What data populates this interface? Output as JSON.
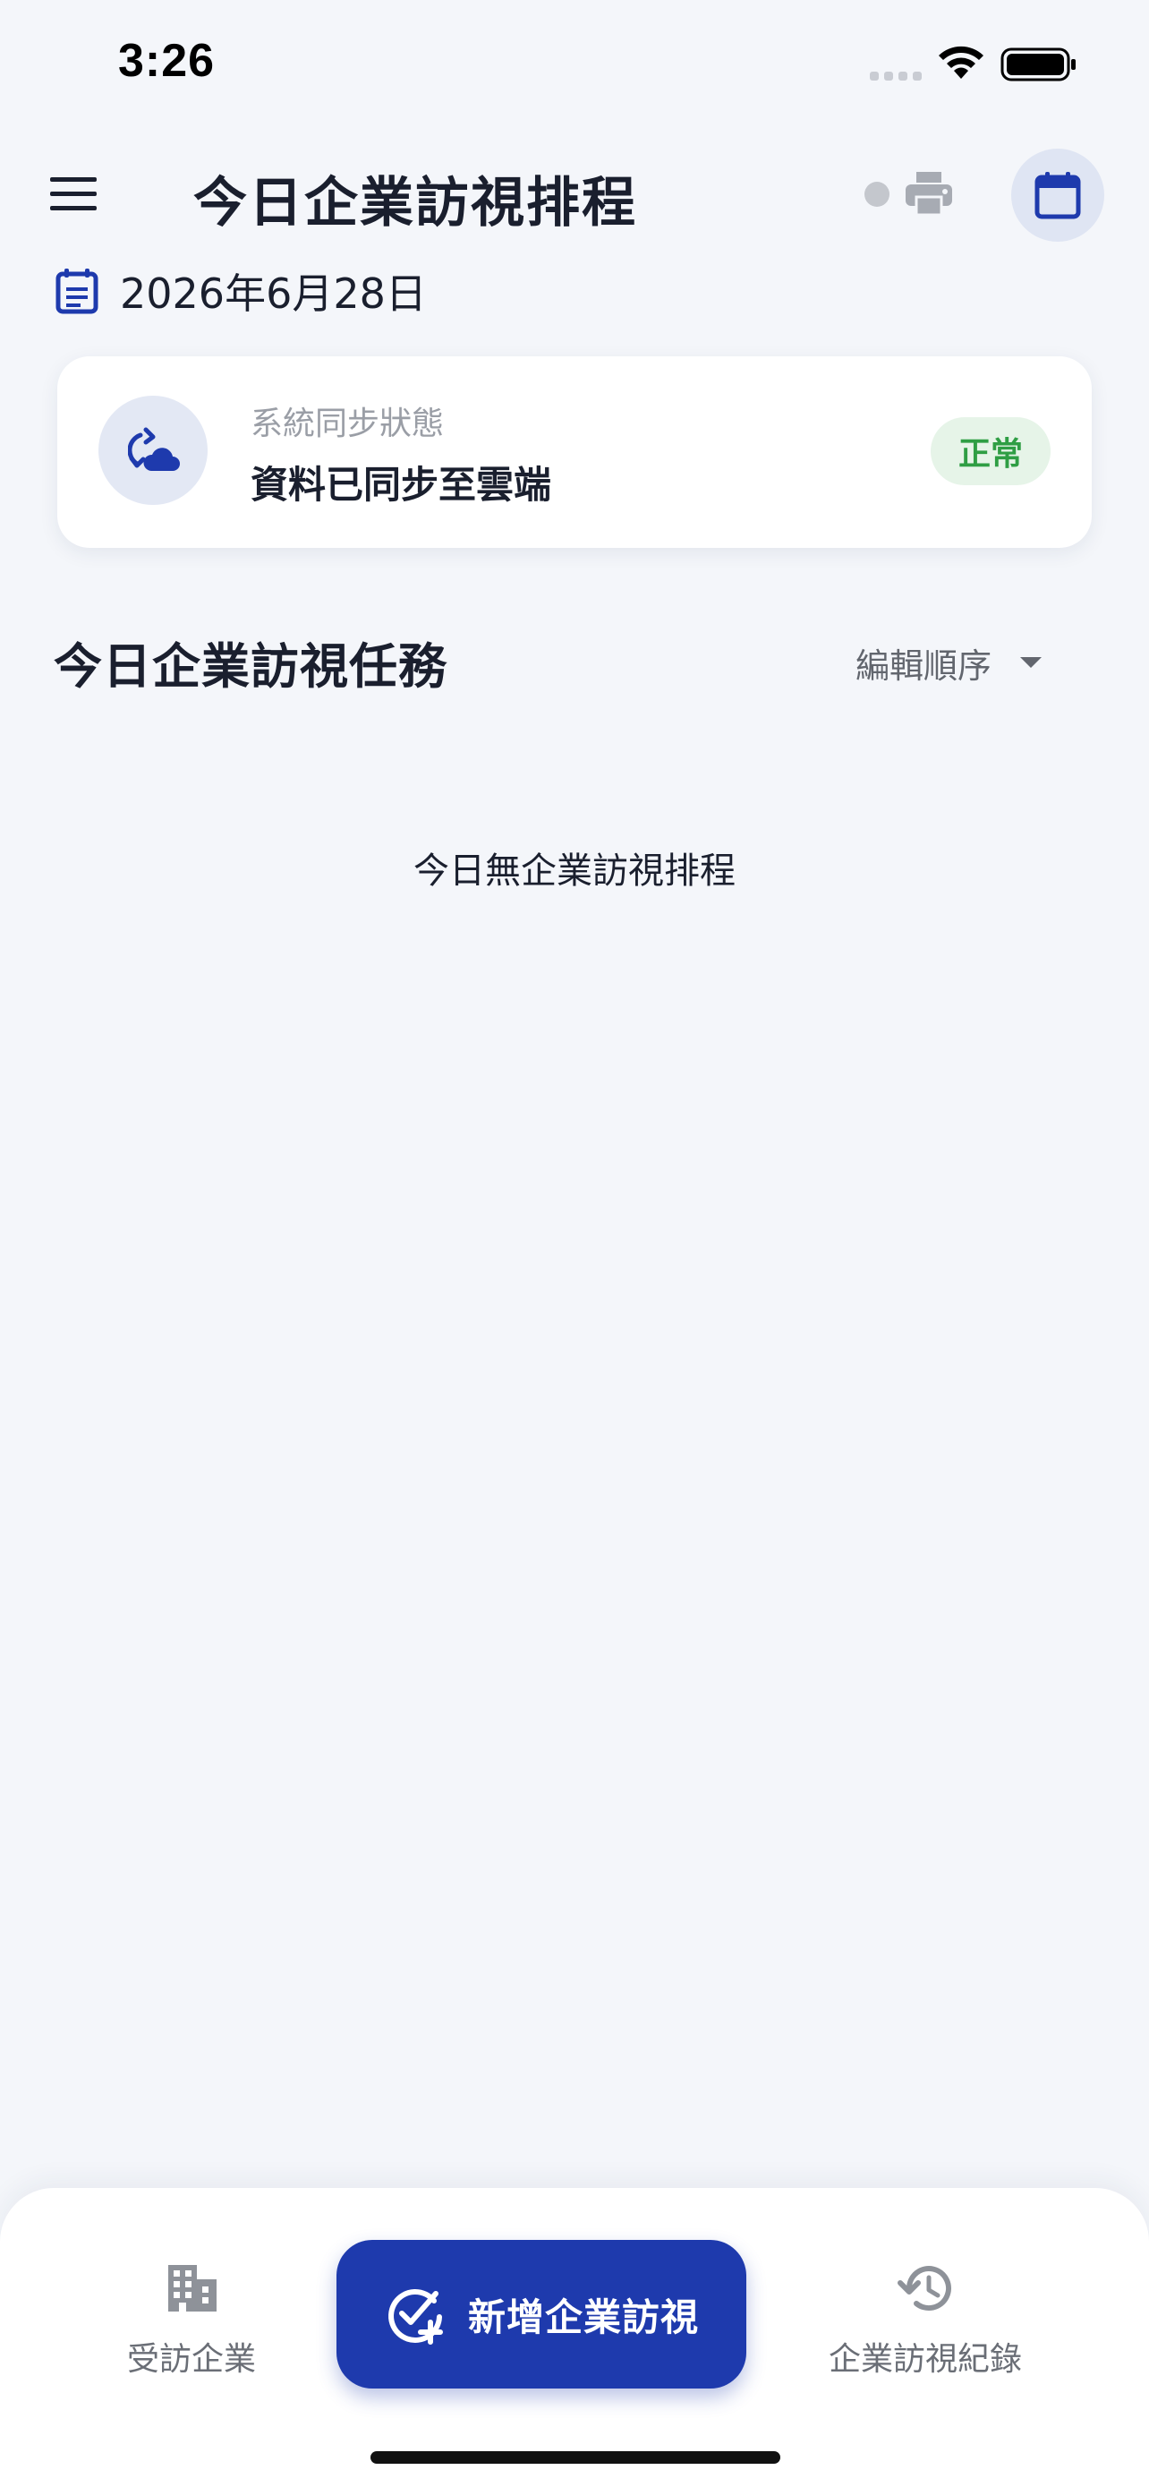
{
  "status_bar": {
    "time": "3:26"
  },
  "header": {
    "title": "今日企業訪視排程",
    "icons": [
      "menu-icon",
      "status-dot",
      "print-icon",
      "calendar-icon"
    ]
  },
  "date": {
    "text": "2026年6月28日",
    "icon": "event-note-icon"
  },
  "sync_card": {
    "label": "系統同步狀態",
    "value": "資料已同步至雲端",
    "badge": "正常",
    "icon": "cloud-sync-icon"
  },
  "tasks_section": {
    "title": "今日企業訪視任務",
    "order_label": "編輯順序",
    "empty_message": "今日無企業訪視排程"
  },
  "bottom_nav": {
    "companies_label": "受訪企業",
    "add_visit_label": "新增企業訪視",
    "history_label": "企業訪視紀錄"
  },
  "colors": {
    "primary": "#1e3aad",
    "background": "#f4f6fa",
    "badge_bg": "#e6f4e8",
    "badge_text": "#2f9e44"
  }
}
